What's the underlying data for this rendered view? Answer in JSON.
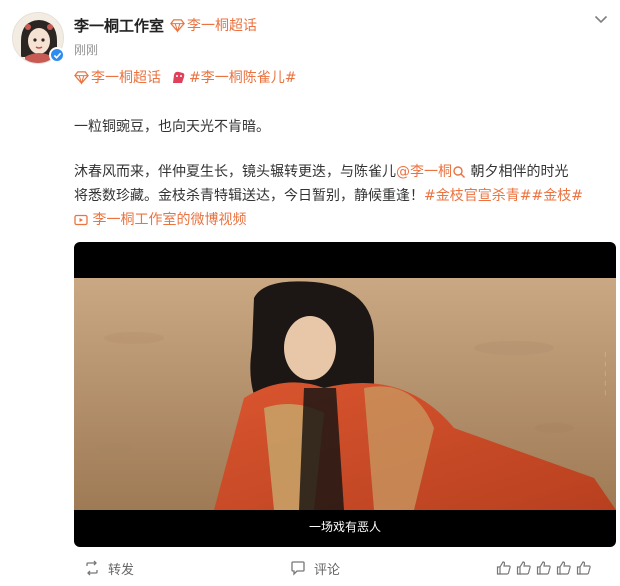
{
  "post": {
    "author_name": "李一桐工作室",
    "author_tag": "李一桐超话",
    "time": "刚刚",
    "topics": {
      "supertopic": "李一桐超话",
      "hashtag": "#李一桐陈雀儿#"
    },
    "body": {
      "line1": "一粒铜豌豆，也向天光不肯暗。",
      "line2_a": "沐春风而来，伴仲夏生长，镜头辗转更迭，与陈雀儿",
      "line2_mention": "@李一桐",
      "line2_b": " 朝夕相伴的时光",
      "line3_a": "将悉数珍藏。金枝杀青特辑送达，今日暂别，静候重逢！",
      "line3_tag1": "#金枝官宣杀青#",
      "line3_tag2": "#金枝#",
      "line4_video": "李一桐工作室的微博视频"
    },
    "video": {
      "subtitle": "一场戏有恶人"
    },
    "actions": {
      "repost": "转发",
      "comment": "评论"
    }
  },
  "colors": {
    "accent": "#eb7340",
    "verify": "#2d8cf0",
    "text": "#333333",
    "muted": "#939393"
  }
}
